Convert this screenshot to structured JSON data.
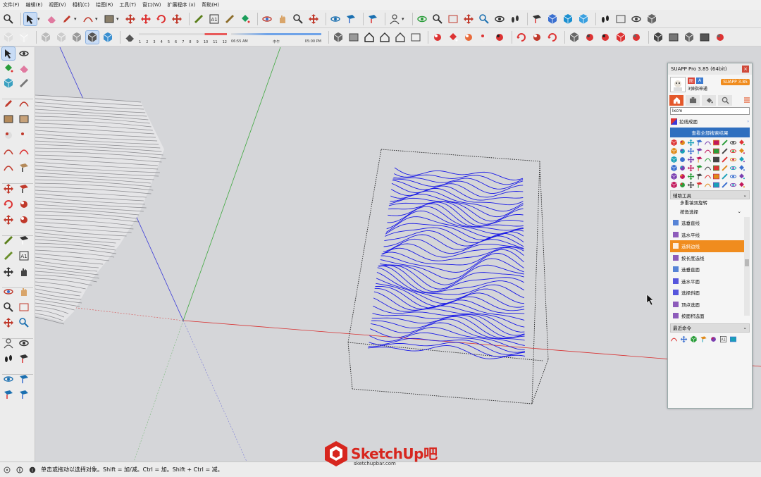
{
  "menu": [
    "文件(F)",
    "编辑(E)",
    "视图(V)",
    "相机(C)",
    "绘图(R)",
    "工具(T)",
    "窗口(W)",
    "扩展程序 (x)",
    "帮助(H)"
  ],
  "shadow_slider": {
    "months": [
      "1",
      "2",
      "3",
      "4",
      "5",
      "6",
      "7",
      "8",
      "9",
      "10",
      "11",
      "12"
    ],
    "time_start": "06:55 AM",
    "time_mid": "中午",
    "time_end": "05:00 PM"
  },
  "panel": {
    "title": "SUAPP Pro 3.85 (64bit)",
    "close": "×",
    "badge_a": "图",
    "badge_b": "A",
    "username": "3弹指神通",
    "version_button": "SUAPP 3.85",
    "search_value": "lxcm",
    "search_result_label": "拉线成面",
    "view_all_button": "查看全部搜索结果",
    "aux_tools_header": "辅助工具",
    "partial_item": "多重镜双旋转",
    "select_dropdown": "按角选择",
    "list_items": [
      "选垂直线",
      "选水平线",
      "选斜边线",
      "按长度选线",
      "选垂直面",
      "选水平面",
      "选择斜面",
      "顶点选面",
      "按面积选面"
    ],
    "active_index": 2,
    "recent_header": "最近命令"
  },
  "status": {
    "text": "单击或拖动以选择对象。Shift = 加/减。Ctrl = 加。Shift + Ctrl = 减。"
  },
  "watermark": {
    "brand": "SketchUp吧",
    "url": "sketchupbar.com"
  },
  "colors": {
    "accent_orange": "#f08c1e",
    "link_blue": "#2f6fbf",
    "wave_blue": "#1a1ae6",
    "axis_red": "#d83030",
    "axis_green": "#3fa83f",
    "axis_blue": "#3a3ad8"
  }
}
